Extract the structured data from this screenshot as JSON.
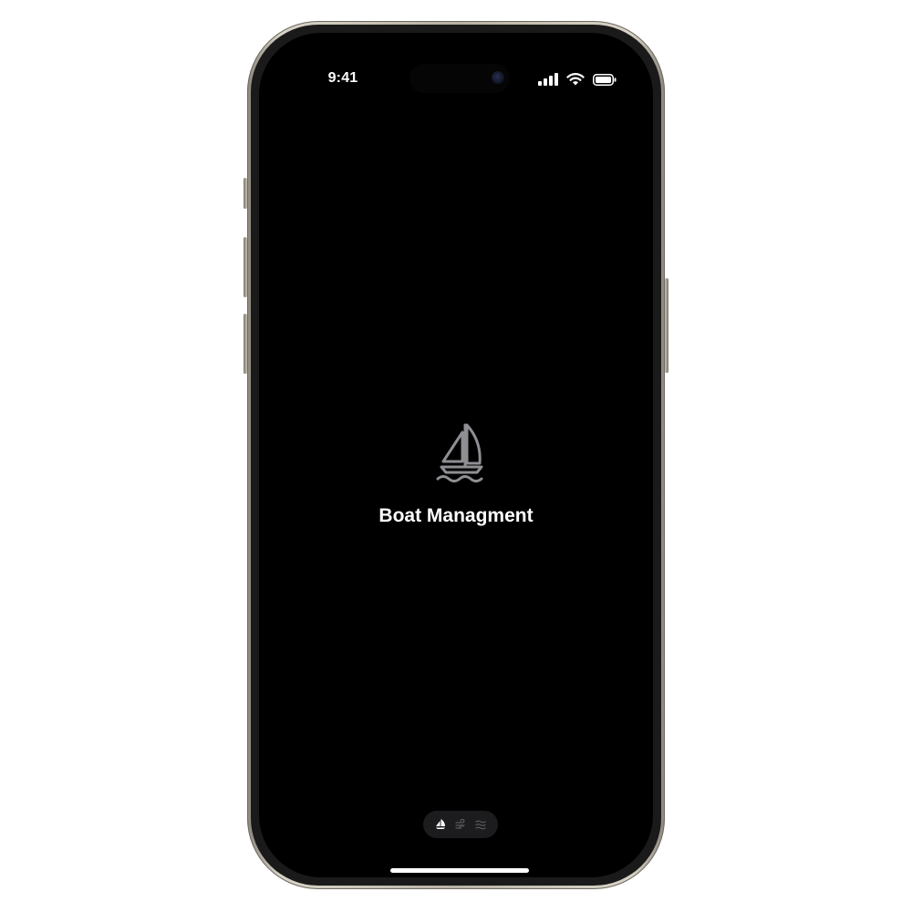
{
  "status_bar": {
    "time": "9:41",
    "icons": [
      "signal-icon",
      "wifi-icon",
      "battery-icon"
    ]
  },
  "splash": {
    "logo_icon": "sailboat-icon",
    "title": "Boat Managment"
  },
  "bottom_pager": {
    "icons": [
      "sailboat-icon",
      "wind-icon",
      "waves-icon"
    ],
    "active_index": 0
  },
  "colors": {
    "screen_background": "#000000",
    "text": "#ffffff",
    "logo_stroke": "#8e8e93",
    "pager_background": "#1c1c1e"
  }
}
